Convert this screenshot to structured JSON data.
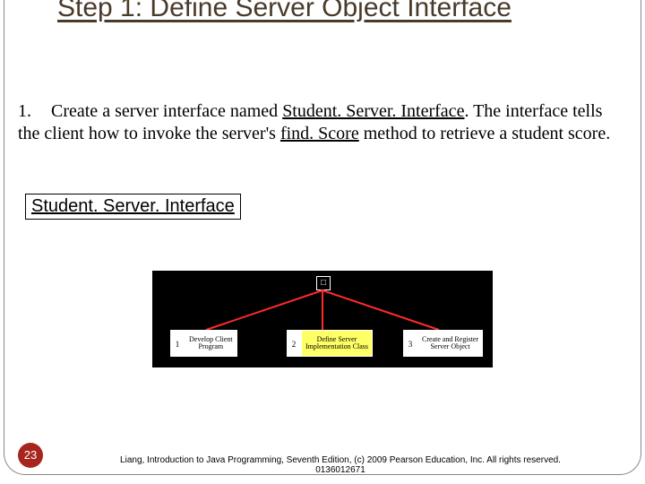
{
  "title": "Step 1: Define Server Object Interface",
  "body": {
    "num": "1.",
    "text_before": "Create a server interface named ",
    "u1": "Student. Server. Interface",
    "text_mid": ". The interface tells the client how to invoke the server's ",
    "u2": "find. Score",
    "text_after": " method to retrieve a student score."
  },
  "link_label": "Student. Server. Interface",
  "diagram": {
    "top_glyph": "□",
    "nodes": [
      {
        "num": "1",
        "label": "Develop Client\nProgram",
        "variant": "white"
      },
      {
        "num": "2",
        "label": "Define Server\nImplementation Class",
        "variant": "yellow"
      },
      {
        "num": "3",
        "label": "Create and Register\nServer Object",
        "variant": "white"
      }
    ]
  },
  "page_number": "23",
  "footer": "Liang, Introduction to Java Programming, Seventh Edition, (c) 2009 Pearson Education, Inc. All rights reserved. 0136012671"
}
